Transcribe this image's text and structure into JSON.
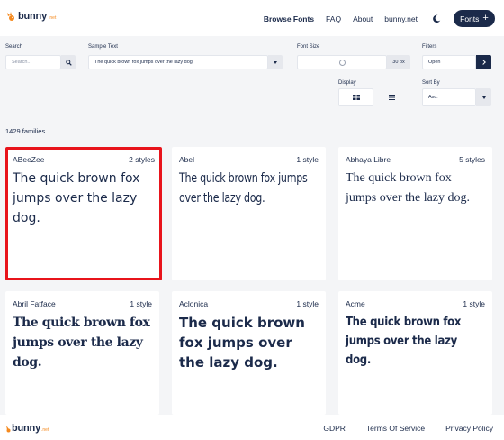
{
  "header": {
    "logo_text": "bunny",
    "logo_tld": ".net",
    "nav": [
      "Browse Fonts",
      "FAQ",
      "About",
      "bunny.net"
    ],
    "fonts_button": "Fonts",
    "fonts_button_icon": "plus-icon",
    "theme_icon": "moon-icon"
  },
  "filters": {
    "search_label": "Search",
    "search_placeholder": "Search...",
    "sample_label": "Sample Text",
    "sample_value": "The quick brown fox jumps over the lazy dog.",
    "size_label": "Font Size",
    "size_value": "30 px",
    "filters_label": "Filters",
    "filters_value": "Open",
    "display_label": "Display",
    "sort_label": "Sort By",
    "sort_value": "Asc."
  },
  "main": {
    "family_count": "1429 families",
    "cards": [
      {
        "name": "ABeeZee",
        "styles": "2 styles",
        "sample": "The quick brown fox jumps over the lazy dog."
      },
      {
        "name": "Abel",
        "styles": "1 style",
        "sample": "The quick brown fox jumps over the lazy dog."
      },
      {
        "name": "Abhaya Libre",
        "styles": "5 styles",
        "sample": "The quick brown fox jumps over the lazy dog."
      },
      {
        "name": "Abril Fatface",
        "styles": "1 style",
        "sample": "The quick brown fox jumps over the lazy dog."
      },
      {
        "name": "Aclonica",
        "styles": "1 style",
        "sample": "The quick brown fox jumps over the lazy dog."
      },
      {
        "name": "Acme",
        "styles": "1 style",
        "sample": "The quick brown fox jumps over the lazy dog."
      }
    ]
  },
  "footer": {
    "logo_text": "bunny",
    "logo_tld": ".net",
    "links": [
      "GDPR",
      "Terms Of Service",
      "Privacy Policy"
    ]
  },
  "colors": {
    "brand_navy": "#1b2a4a",
    "brand_orange": "#f58a1f",
    "selection_red": "#e8141b"
  }
}
